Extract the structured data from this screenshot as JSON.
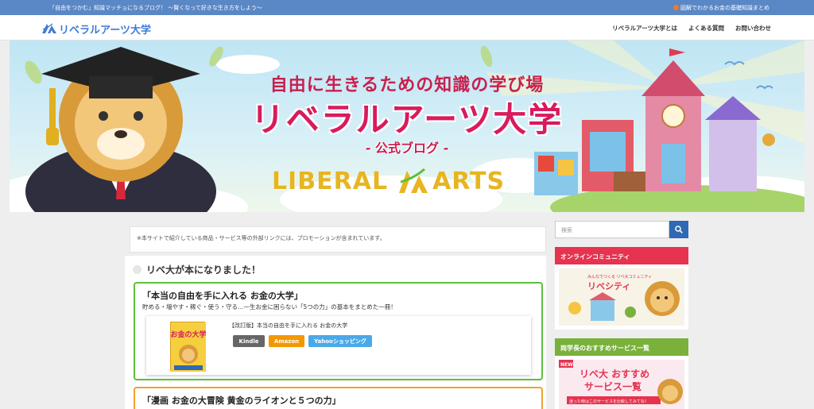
{
  "topbar": {
    "tagline": "「自由をつかむ」知識マッチョになるブログ！ 〜賢くなって好きな生き方をしよう〜",
    "right_link": "図解でわかるお金の基礎知識まとめ"
  },
  "header": {
    "logo_text": "リベラルアーツ大学",
    "nav": [
      "リベラルアーツ大学とは",
      "よくある質問",
      "お問い合わせ"
    ]
  },
  "hero": {
    "subtitle": "自由に生きるための知識の学び場",
    "title": "リベラルアーツ大学",
    "blog_label": "- 公式ブログ -",
    "brand_left": "LIBERAL",
    "brand_right": "ARTS"
  },
  "notice": "※本サイトで紹介している商品・サービス等の外部リンクには、プロモーションが含まれています。",
  "article": {
    "heading": "リベ大が本になりました！",
    "book1": {
      "title": "「本当の自由を手に入れる お金の大学」",
      "description": "貯める・増やす・稼ぐ・使う・守る…一生お金に困らない「5つの力」の基本をまとめた一冊！",
      "card_title": "【改訂版】本当の自由を手に入れる お金の大学",
      "cover_text": "お金の大学",
      "buttons": [
        "Kindle",
        "Amazon",
        "Yahooショッピング"
      ]
    },
    "book2": {
      "title": "「漫画 お金の大冒険 黄金のライオンと５つの力」"
    }
  },
  "sidebar": {
    "search_placeholder": "検索",
    "widget1": {
      "heading": "オンラインコミュニティ",
      "banner_top": "みんなでつくる リベ大コミュニティ",
      "banner_main": "リベシティ"
    },
    "widget2": {
      "heading": "両学長のおすすめサービス一覧",
      "badge": "NEW",
      "banner_line1": "リベ大 おすすめ",
      "banner_line2": "サービス一覧",
      "banner_bottom": "迷った時はこのサービスを比較してみてね！"
    }
  },
  "colors": {
    "topbar": "#5a87c5",
    "accent_blue": "#3e7ad6",
    "hero_title": "#d81b5c",
    "border_green": "#5cbf3a",
    "border_orange": "#f0a030",
    "widget_red": "#e6334f",
    "widget_green": "#79b13a"
  }
}
